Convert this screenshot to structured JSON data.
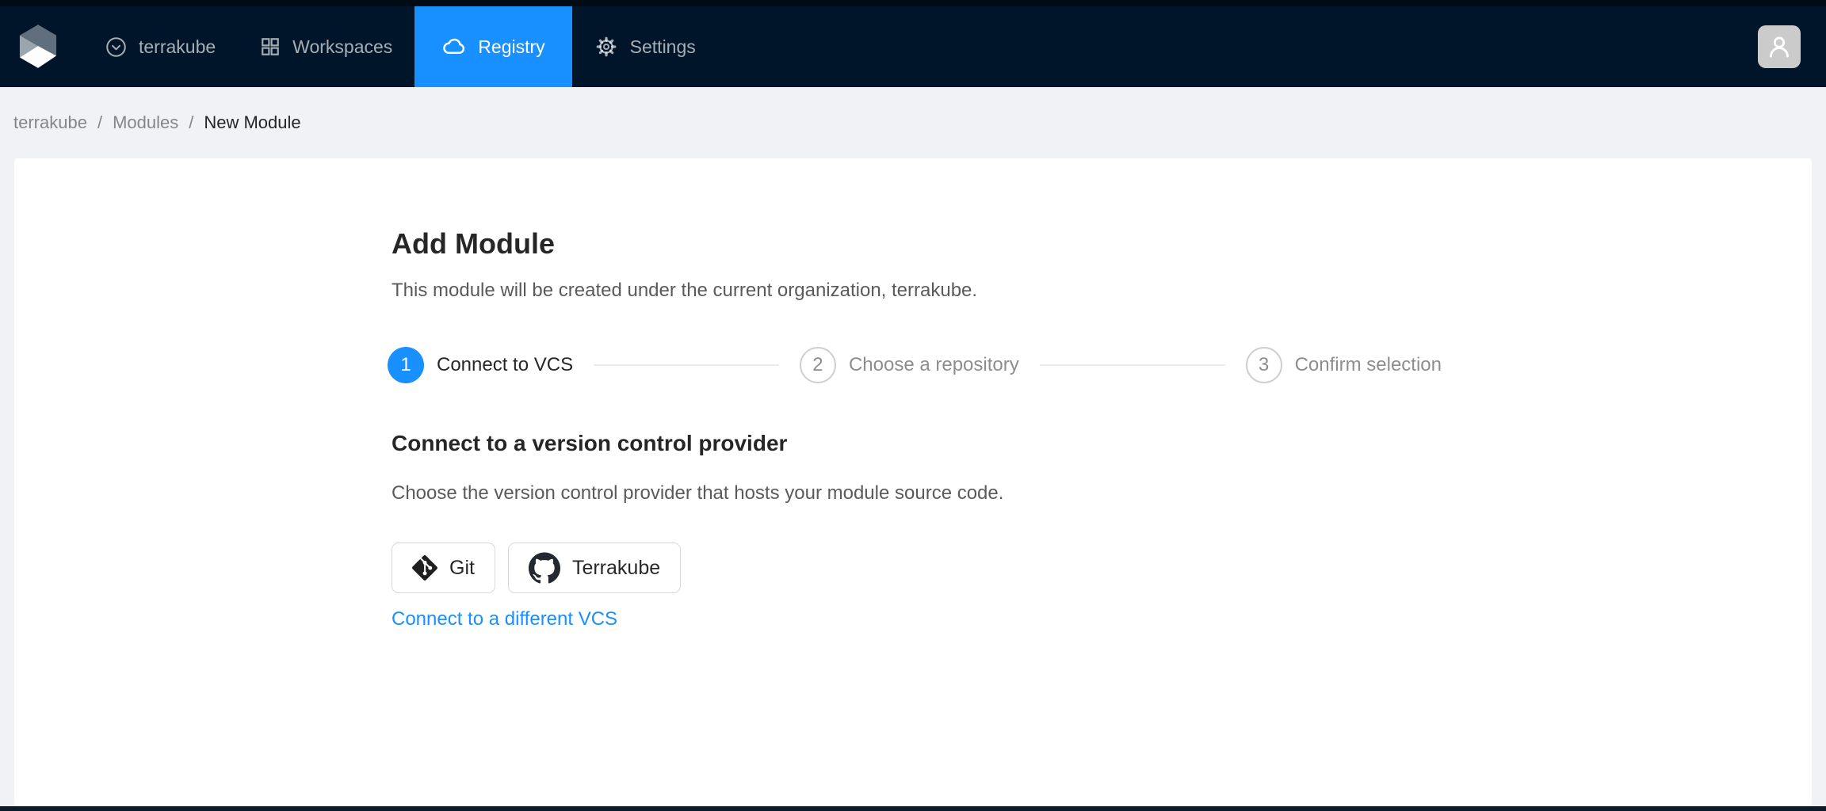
{
  "navbar": {
    "items": [
      {
        "label": "terrakube",
        "icon": "down-circle-icon",
        "active": false
      },
      {
        "label": "Workspaces",
        "icon": "appstore-icon",
        "active": false
      },
      {
        "label": "Registry",
        "icon": "cloud-icon",
        "active": true
      },
      {
        "label": "Settings",
        "icon": "gear-icon",
        "active": false
      }
    ]
  },
  "breadcrumb": {
    "separator": "/",
    "items": [
      "terrakube",
      "Modules",
      "New Module"
    ]
  },
  "page": {
    "title": "Add Module",
    "subtitle": "This module will be created under the current organization, terrakube.",
    "steps": [
      {
        "number": "1",
        "label": "Connect to VCS",
        "state": "active"
      },
      {
        "number": "2",
        "label": "Choose a repository",
        "state": "wait"
      },
      {
        "number": "3",
        "label": "Confirm selection",
        "state": "wait"
      }
    ],
    "section": {
      "heading": "Connect to a version control provider",
      "description": "Choose the version control provider that hosts your module source code.",
      "buttons": [
        {
          "label": "Git",
          "icon": "git-icon"
        },
        {
          "label": "Terrakube",
          "icon": "github-icon"
        }
      ],
      "link": "Connect to a different VCS"
    }
  },
  "colors": {
    "primary": "#1890ff",
    "navbar_bg": "#001529",
    "page_bg": "#f0f2f5",
    "card_bg": "#ffffff",
    "link": "#1890ff"
  }
}
